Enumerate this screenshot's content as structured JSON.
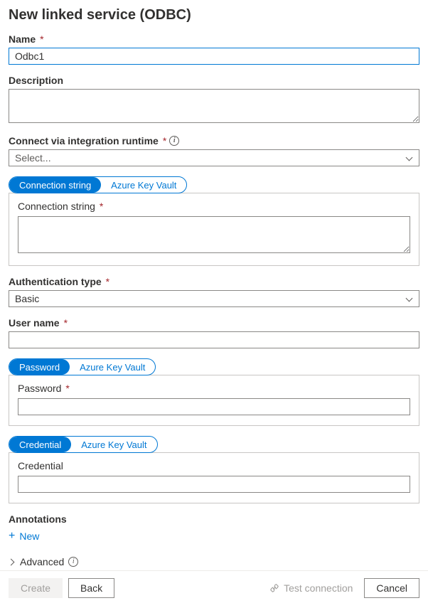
{
  "title": "New linked service (ODBC)",
  "fields": {
    "name": {
      "label": "Name",
      "required": true,
      "value": "Odbc1"
    },
    "description": {
      "label": "Description",
      "required": false,
      "value": ""
    },
    "runtime": {
      "label": "Connect via integration runtime",
      "required": true,
      "info": true,
      "placeholder": "Select...",
      "value": ""
    },
    "auth_type": {
      "label": "Authentication type",
      "required": true,
      "value": "Basic"
    },
    "user_name": {
      "label": "User name",
      "required": true,
      "value": ""
    },
    "annotations": {
      "label": "Annotations"
    },
    "advanced": {
      "label": "Advanced",
      "info": true
    }
  },
  "tabs": {
    "connection_string": {
      "options": [
        "Connection string",
        "Azure Key Vault"
      ],
      "active": 0,
      "panel_label": "Connection string",
      "panel_required": true,
      "value": ""
    },
    "password": {
      "options": [
        "Password",
        "Azure Key Vault"
      ],
      "active": 0,
      "panel_label": "Password",
      "panel_required": true,
      "value": ""
    },
    "credential": {
      "options": [
        "Credential",
        "Azure Key Vault"
      ],
      "active": 0,
      "panel_label": "Credential",
      "panel_required": false,
      "value": ""
    }
  },
  "annotations_new": "New",
  "footer": {
    "create": "Create",
    "back": "Back",
    "test": "Test connection",
    "cancel": "Cancel"
  },
  "asterisk": "*"
}
